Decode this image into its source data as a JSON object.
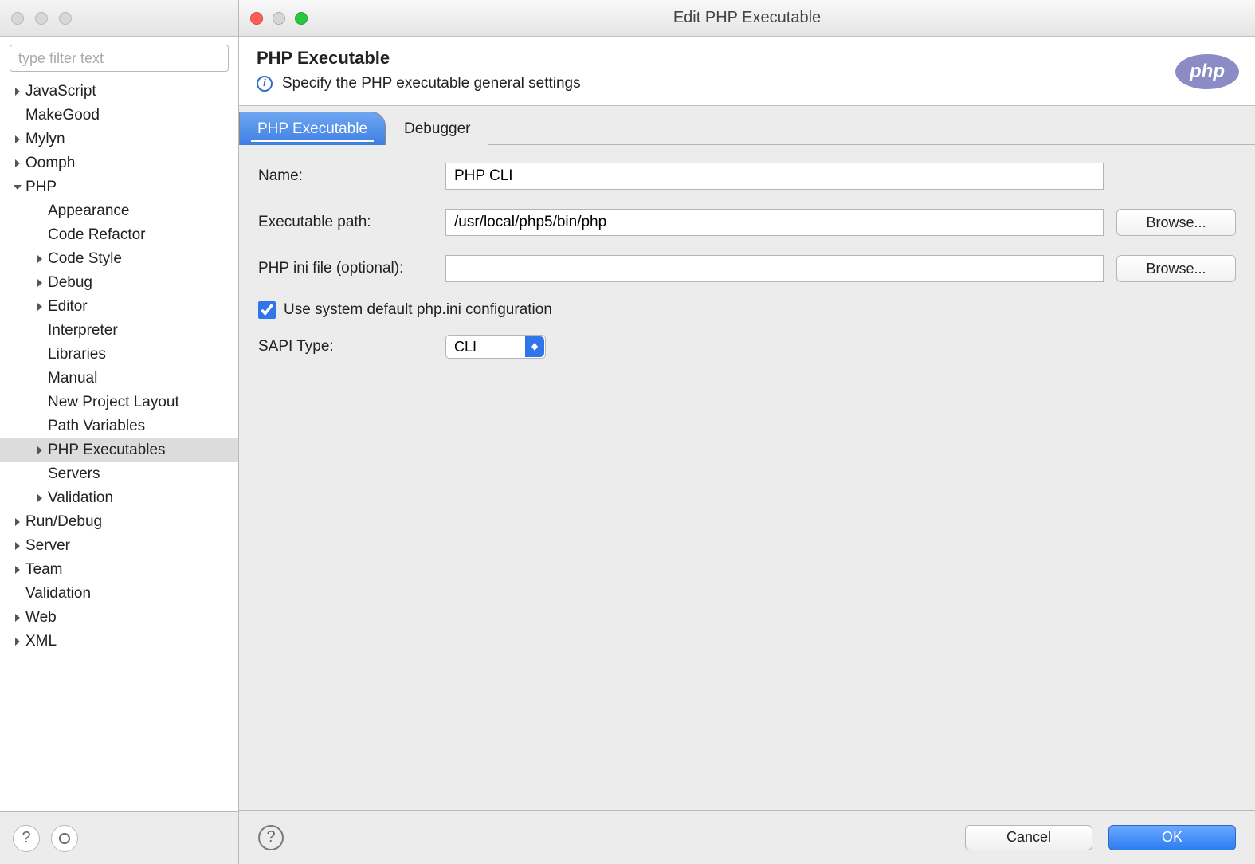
{
  "left": {
    "filter_placeholder": "type filter text",
    "tree": [
      {
        "label": "JavaScript",
        "depth": 0,
        "twisty": "right",
        "selected": false
      },
      {
        "label": "MakeGood",
        "depth": 0,
        "twisty": "none",
        "selected": false
      },
      {
        "label": "Mylyn",
        "depth": 0,
        "twisty": "right",
        "selected": false
      },
      {
        "label": "Oomph",
        "depth": 0,
        "twisty": "right",
        "selected": false
      },
      {
        "label": "PHP",
        "depth": 0,
        "twisty": "down",
        "selected": false
      },
      {
        "label": "Appearance",
        "depth": 1,
        "twisty": "none",
        "selected": false
      },
      {
        "label": "Code Refactor",
        "depth": 1,
        "twisty": "none",
        "selected": false
      },
      {
        "label": "Code Style",
        "depth": 1,
        "twisty": "right",
        "selected": false
      },
      {
        "label": "Debug",
        "depth": 1,
        "twisty": "right",
        "selected": false
      },
      {
        "label": "Editor",
        "depth": 1,
        "twisty": "right",
        "selected": false
      },
      {
        "label": "Interpreter",
        "depth": 1,
        "twisty": "none",
        "selected": false
      },
      {
        "label": "Libraries",
        "depth": 1,
        "twisty": "none",
        "selected": false
      },
      {
        "label": "Manual",
        "depth": 1,
        "twisty": "none",
        "selected": false
      },
      {
        "label": "New Project Layout",
        "depth": 1,
        "twisty": "none",
        "selected": false
      },
      {
        "label": "Path Variables",
        "depth": 1,
        "twisty": "none",
        "selected": false
      },
      {
        "label": "PHP Executables",
        "depth": 1,
        "twisty": "right",
        "selected": true
      },
      {
        "label": "Servers",
        "depth": 1,
        "twisty": "none",
        "selected": false
      },
      {
        "label": "Validation",
        "depth": 1,
        "twisty": "right",
        "selected": false
      },
      {
        "label": "Run/Debug",
        "depth": 0,
        "twisty": "right",
        "selected": false
      },
      {
        "label": "Server",
        "depth": 0,
        "twisty": "right",
        "selected": false
      },
      {
        "label": "Team",
        "depth": 0,
        "twisty": "right",
        "selected": false
      },
      {
        "label": "Validation",
        "depth": 0,
        "twisty": "none",
        "selected": false
      },
      {
        "label": "Web",
        "depth": 0,
        "twisty": "right",
        "selected": false
      },
      {
        "label": "XML",
        "depth": 0,
        "twisty": "right",
        "selected": false
      }
    ]
  },
  "dialog": {
    "window_title": "Edit PHP Executable",
    "header_title": "PHP Executable",
    "header_subtitle": "Specify the PHP executable general settings",
    "php_logo_text": "php",
    "tabs": {
      "active": "PHP Executable",
      "other": "Debugger"
    },
    "form": {
      "name_label": "Name:",
      "name_value": "PHP CLI",
      "exec_label": "Executable path:",
      "exec_value": "/usr/local/php5/bin/php",
      "ini_label": "PHP ini file (optional):",
      "ini_value": "",
      "browse_label": "Browse...",
      "default_ini_label": "Use system default php.ini configuration",
      "default_ini_checked": true,
      "sapi_label": "SAPI Type:",
      "sapi_value": "CLI"
    },
    "buttons": {
      "cancel": "Cancel",
      "ok": "OK"
    }
  }
}
